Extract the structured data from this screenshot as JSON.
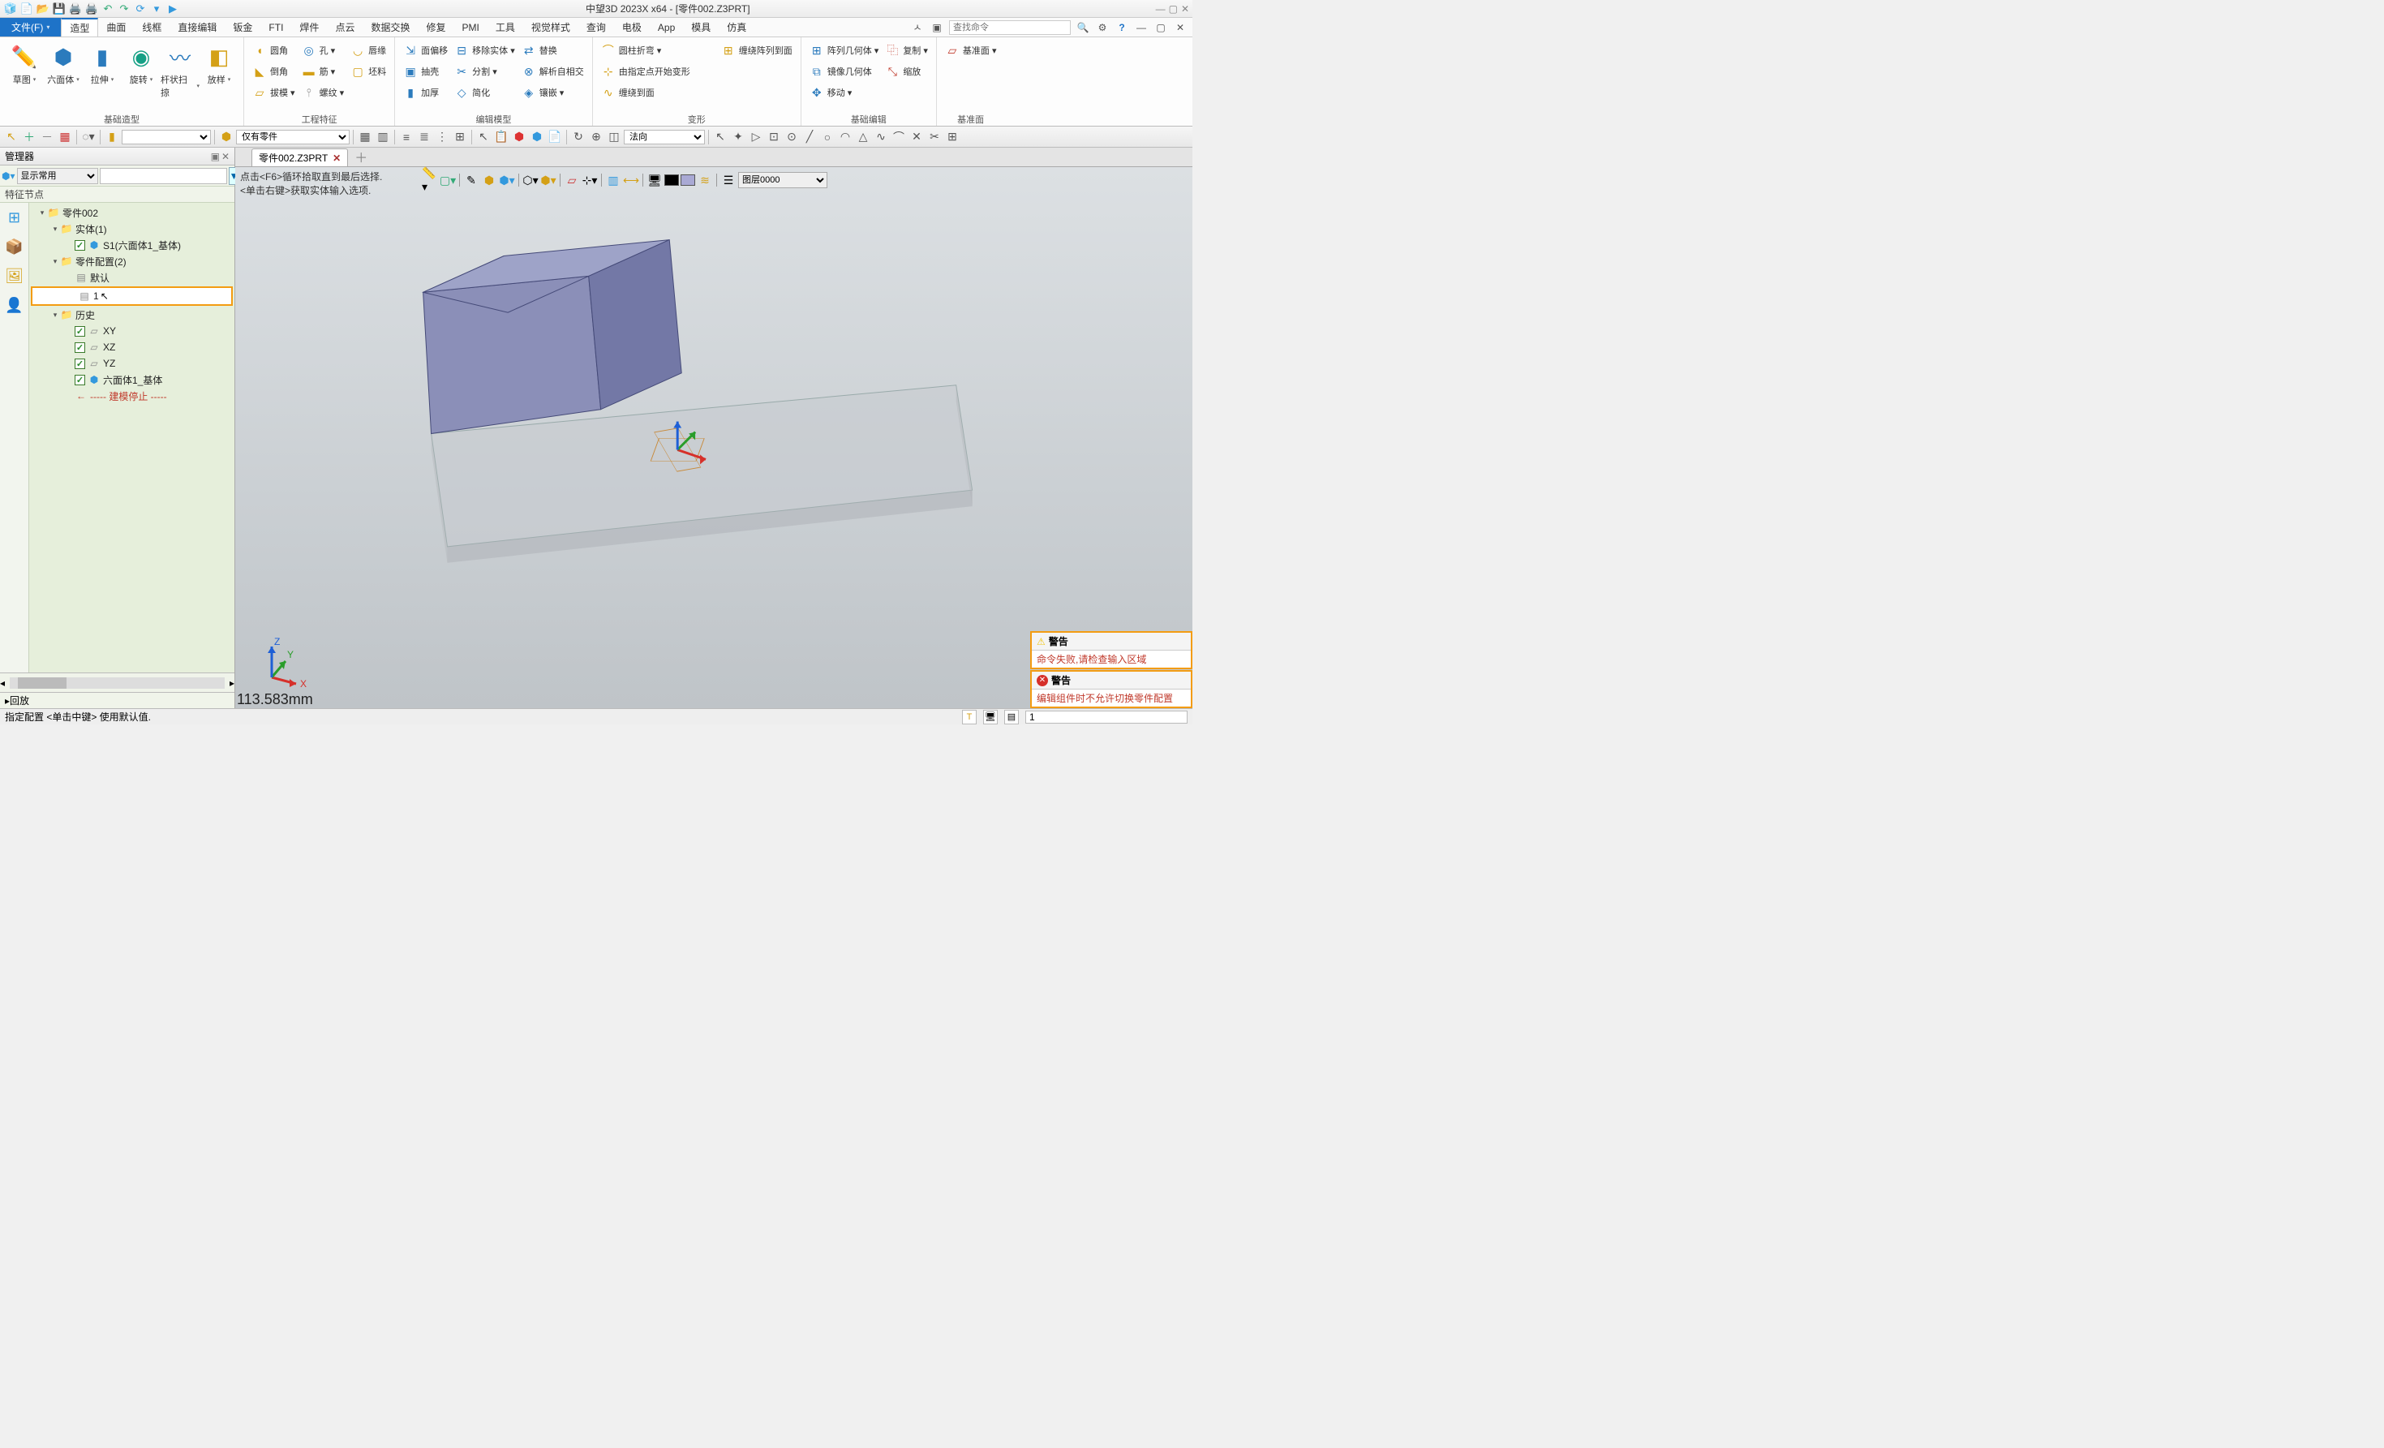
{
  "title": "中望3D 2023X x64 - [零件002.Z3PRT]",
  "menu": {
    "file": "文件(F)",
    "tabs": [
      "造型",
      "曲面",
      "线框",
      "直接编辑",
      "钣金",
      "FTI",
      "焊件",
      "点云",
      "数据交换",
      "修复",
      "PMI",
      "工具",
      "视觉样式",
      "查询",
      "电极",
      "App",
      "模具",
      "仿真"
    ],
    "activeIndex": 0,
    "searchPlaceholder": "查找命令"
  },
  "ribbon": {
    "g1": {
      "label": "基础造型",
      "big": [
        {
          "t": "草图",
          "c": "#e67e22"
        },
        {
          "t": "六面体",
          "c": "#2b7bbd"
        },
        {
          "t": "拉伸",
          "c": "#2b7bbd"
        },
        {
          "t": "旋转",
          "c": "#16a085"
        },
        {
          "t": "杆状扫掠",
          "c": "#2b7bbd"
        },
        {
          "t": "放样",
          "c": "#d4a016"
        }
      ]
    },
    "g2": {
      "label": "工程特征",
      "rows": [
        [
          "圆角",
          "孔 ▾",
          "唇缘"
        ],
        [
          "倒角",
          "筋 ▾",
          "坯料"
        ],
        [
          "拔模 ▾",
          "螺纹 ▾",
          ""
        ]
      ]
    },
    "g3": {
      "label": "编辑模型",
      "rows": [
        [
          "面偏移",
          "移除实体 ▾",
          "替换"
        ],
        [
          "抽壳",
          "分割 ▾",
          "解析自相交"
        ],
        [
          "加厚",
          "简化",
          "镶嵌 ▾"
        ]
      ]
    },
    "g4": {
      "label": "变形",
      "rows": [
        [
          "圆柱折弯 ▾"
        ],
        [
          "由指定点开始变形"
        ],
        [
          "缠绕到面"
        ]
      ],
      "extra": "缠绕阵列到面"
    },
    "g5": {
      "label": "基础编辑",
      "rows": [
        [
          "阵列几何体 ▾",
          "复制 ▾"
        ],
        [
          "镜像几何体",
          "缩放"
        ],
        [
          "移动 ▾",
          ""
        ]
      ]
    },
    "g6": {
      "label": "基准面",
      "rows": [
        [
          "基准面 ▾"
        ]
      ]
    }
  },
  "strip": {
    "onlyParts": "仅有零件",
    "normal": "法向"
  },
  "manager": {
    "title": "管理器",
    "displayMode": "显示常用",
    "section": "特征节点",
    "root": "零件002",
    "solids": "实体(1)",
    "s1": "S1(六面体1_基体)",
    "configs": "零件配置(2)",
    "cfgDefault": "默认",
    "cfg1": "1",
    "history": "历史",
    "xy": "XY",
    "xz": "XZ",
    "yz": "YZ",
    "hex": "六面体1_基体",
    "stop": "-----  建模停止  -----",
    "playback": "回放"
  },
  "viewport": {
    "tab": "零件002.Z3PRT",
    "hint1": "点击<F6>循环拾取直到最后选择.",
    "hint2": "<单击右键>获取实体输入选项.",
    "layer": "图层0000",
    "mm": "113.583mm"
  },
  "axes": {
    "x": "X",
    "y": "Y",
    "z": "Z"
  },
  "warn": {
    "t": "警告",
    "m1": "命令失败,请检查输入区域",
    "m2": "编辑组件时不允许切换零件配置"
  },
  "status": {
    "msg": "指定配置  <单击中键> 使用默认值.",
    "val": "1"
  }
}
